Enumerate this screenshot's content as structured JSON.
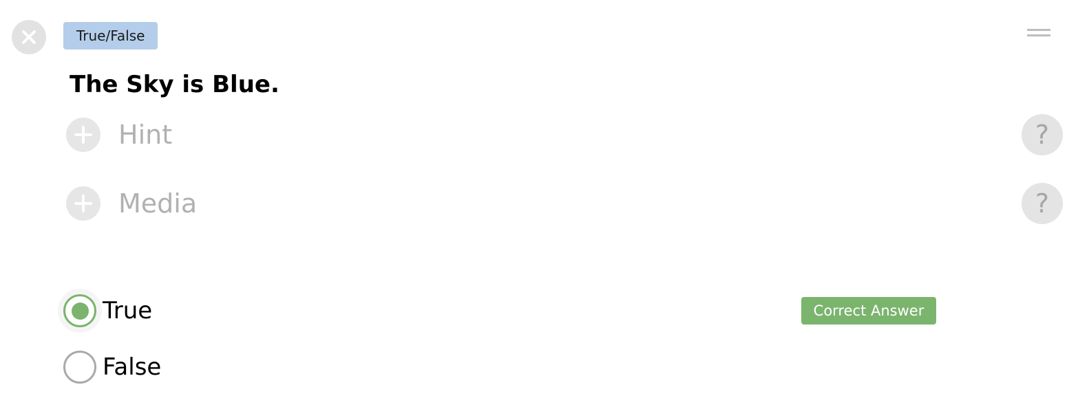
{
  "question": {
    "type_badge": "True/False",
    "text": "The Sky is Blue."
  },
  "sections": {
    "hint": {
      "label": "Hint",
      "help_symbol": "?"
    },
    "media": {
      "label": "Media",
      "help_symbol": "?"
    }
  },
  "answers": {
    "options": [
      {
        "label": "True",
        "selected": true
      },
      {
        "label": "False",
        "selected": false
      }
    ],
    "correct_label": "Correct Answer"
  },
  "icons": {
    "remove": "close-icon",
    "drag": "drag-handle-icon",
    "add": "plus-icon",
    "help": "question-mark-icon"
  },
  "colors": {
    "badge_background": "#b4cdea",
    "correct_green": "#7ab46d",
    "muted_gray": "#b1b1b1"
  }
}
